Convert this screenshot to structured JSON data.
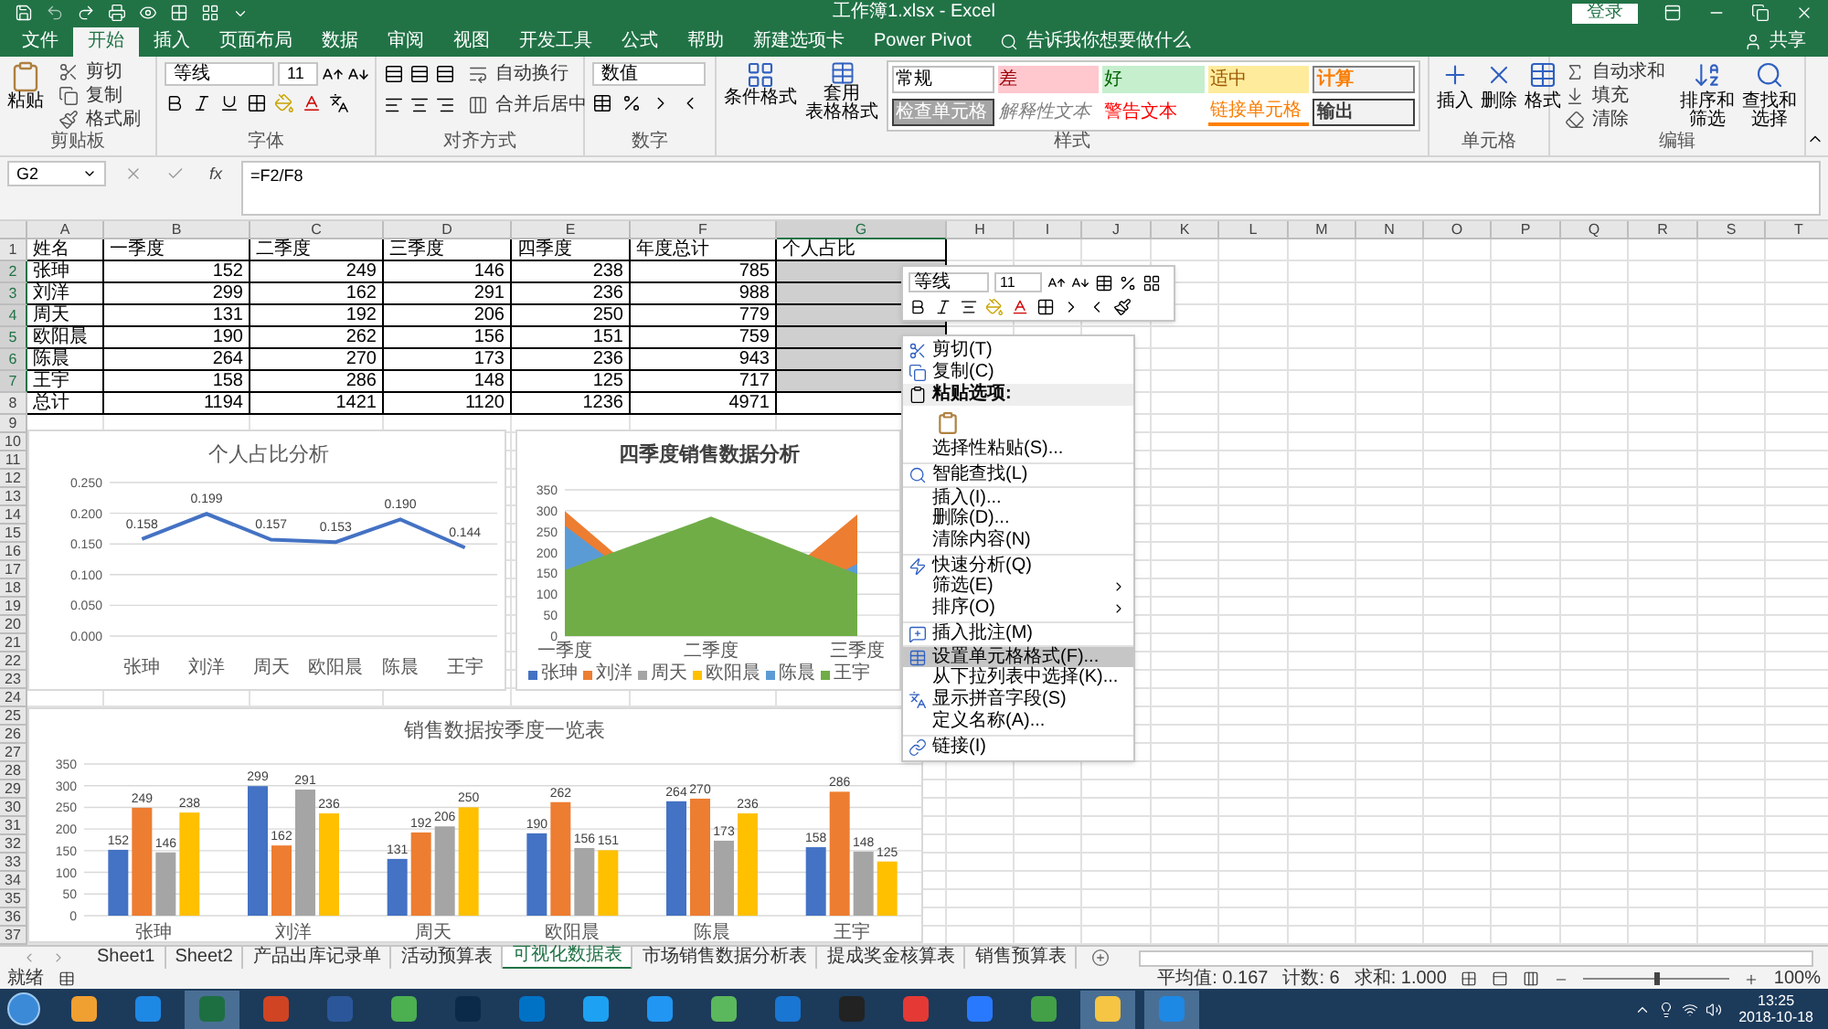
{
  "title_bar": {
    "title": "工作簿1.xlsx  -  Excel",
    "login": "登录",
    "share": "共享"
  },
  "ribbon_tabs": [
    {
      "label": "文件",
      "selected": false
    },
    {
      "label": "开始",
      "selected": true
    },
    {
      "label": "插入",
      "selected": false
    },
    {
      "label": "页面布局",
      "selected": false
    },
    {
      "label": "数据",
      "selected": false
    },
    {
      "label": "审阅",
      "selected": false
    },
    {
      "label": "视图",
      "selected": false
    },
    {
      "label": "开发工具",
      "selected": false
    },
    {
      "label": "公式",
      "selected": false
    },
    {
      "label": "帮助",
      "selected": false
    },
    {
      "label": "新建选项卡",
      "selected": false
    },
    {
      "label": "Power Pivot",
      "selected": false
    }
  ],
  "tell_me": "告诉我你想要做什么",
  "ribbon": {
    "clipboard": {
      "label": "剪贴板",
      "paste": "粘贴",
      "cut": "剪切",
      "copy": "复制",
      "format_painter": "格式刷"
    },
    "font": {
      "label": "字体",
      "font_name": "等线",
      "font_size": "11"
    },
    "alignment": {
      "label": "对齐方式",
      "wrap": "自动换行",
      "merge": "合并后居中"
    },
    "number": {
      "label": "数字",
      "format": "数值"
    },
    "styles": {
      "label": "样式",
      "conditional": "条件格式",
      "table_format": [
        "套用",
        "表格格式"
      ],
      "gallery": [
        {
          "text": "常规",
          "kind": "normal"
        },
        {
          "text": "差",
          "kind": "bad"
        },
        {
          "text": "好",
          "kind": "good"
        },
        {
          "text": "适中",
          "kind": "neutral"
        },
        {
          "text": "计算",
          "kind": "calculation"
        },
        {
          "text": "检查单元格",
          "kind": "check"
        },
        {
          "text": "解释性文本",
          "kind": "explanatory"
        },
        {
          "text": "警告文本",
          "kind": "warning"
        },
        {
          "text": "链接单元格",
          "kind": "linked"
        },
        {
          "text": "输出",
          "kind": "output"
        }
      ]
    },
    "cells": {
      "label": "单元格",
      "buttons": [
        "插入",
        "删除",
        "格式"
      ]
    },
    "editing": {
      "label": "编辑",
      "autosum": "自动求和",
      "fill": "填充",
      "clear": "清除",
      "sort": "排序和筛选",
      "find": "查找和选择"
    }
  },
  "formula_bar": {
    "name_box": "G2",
    "fx": "fx",
    "formula": "=F2/F8"
  },
  "sheet": {
    "columns": [
      {
        "label": "A",
        "selected": false
      },
      {
        "label": "B",
        "selected": false
      },
      {
        "label": "C",
        "selected": false
      },
      {
        "label": "D",
        "selected": false
      },
      {
        "label": "E",
        "selected": false
      },
      {
        "label": "F",
        "selected": false
      },
      {
        "label": "G",
        "selected": true
      },
      {
        "label": "H",
        "selected": false
      },
      {
        "label": "I",
        "selected": false
      },
      {
        "label": "J",
        "selected": false
      },
      {
        "label": "K",
        "selected": false
      },
      {
        "label": "L",
        "selected": false
      },
      {
        "label": "M",
        "selected": false
      },
      {
        "label": "N",
        "selected": false
      },
      {
        "label": "O",
        "selected": false
      },
      {
        "label": "P",
        "selected": false
      },
      {
        "label": "Q",
        "selected": false
      },
      {
        "label": "R",
        "selected": false
      },
      {
        "label": "S",
        "selected": false
      },
      {
        "label": "T",
        "selected": false
      }
    ],
    "rows": [
      {
        "number": "1",
        "selected": false,
        "cells": [
          {
            "text": "姓名",
            "selected": false
          },
          {
            "text": "一季度",
            "selected": false
          },
          {
            "text": "二季度",
            "selected": false
          },
          {
            "text": "三季度",
            "selected": false
          },
          {
            "text": "四季度",
            "selected": false
          },
          {
            "text": "年度总计",
            "selected": false
          },
          {
            "text": "个人占比",
            "selected": false
          }
        ]
      },
      {
        "number": "2",
        "selected": true,
        "cells": [
          {
            "text": "张珅",
            "selected": false
          },
          {
            "text": "152",
            "selected": false
          },
          {
            "text": "249",
            "selected": false
          },
          {
            "text": "146",
            "selected": false
          },
          {
            "text": "238",
            "selected": false
          },
          {
            "text": "785",
            "selected": false
          },
          {
            "selected": true
          }
        ]
      },
      {
        "number": "3",
        "selected": true,
        "cells": [
          {
            "text": "刘洋",
            "selected": false
          },
          {
            "text": "299",
            "selected": false
          },
          {
            "text": "162",
            "selected": false
          },
          {
            "text": "291",
            "selected": false
          },
          {
            "text": "236",
            "selected": false
          },
          {
            "text": "988",
            "selected": false
          },
          {
            "selected": true
          }
        ]
      },
      {
        "number": "4",
        "selected": true,
        "cells": [
          {
            "text": "周天",
            "selected": false
          },
          {
            "text": "131",
            "selected": false
          },
          {
            "text": "192",
            "selected": false
          },
          {
            "text": "206",
            "selected": false
          },
          {
            "text": "250",
            "selected": false
          },
          {
            "text": "779",
            "selected": false
          },
          {
            "selected": true
          }
        ]
      },
      {
        "number": "5",
        "selected": true,
        "cells": [
          {
            "text": "欧阳晨",
            "selected": false
          },
          {
            "text": "190",
            "selected": false
          },
          {
            "text": "262",
            "selected": false
          },
          {
            "text": "156",
            "selected": false
          },
          {
            "text": "151",
            "selected": false
          },
          {
            "text": "759",
            "selected": false
          },
          {
            "selected": true
          }
        ]
      },
      {
        "number": "6",
        "selected": true,
        "cells": [
          {
            "text": "陈晨",
            "selected": false
          },
          {
            "text": "264",
            "selected": false
          },
          {
            "text": "270",
            "selected": false
          },
          {
            "text": "173",
            "selected": false
          },
          {
            "text": "236",
            "selected": false
          },
          {
            "text": "943",
            "selected": false
          },
          {
            "selected": true
          }
        ]
      },
      {
        "number": "7",
        "selected": true,
        "cells": [
          {
            "text": "王宇",
            "selected": false
          },
          {
            "text": "158",
            "selected": false
          },
          {
            "text": "286",
            "selected": false
          },
          {
            "text": "148",
            "selected": false
          },
          {
            "text": "125",
            "selected": false
          },
          {
            "text": "717",
            "selected": false
          },
          {
            "selected": true
          }
        ]
      },
      {
        "number": "8",
        "selected": false,
        "cells": [
          {
            "text": "总计",
            "selected": false
          },
          {
            "text": "1194",
            "selected": false
          },
          {
            "text": "1421",
            "selected": false
          },
          {
            "text": "1120",
            "selected": false
          },
          {
            "text": "1236",
            "selected": false
          },
          {
            "text": "4971",
            "selected": false
          },
          {
            "selected": false
          }
        ]
      },
      {
        "number": "9",
        "selected": false
      },
      {
        "number": "10",
        "selected": false
      },
      {
        "number": "11",
        "selected": false
      },
      {
        "number": "12",
        "selected": false
      },
      {
        "number": "13",
        "selected": false
      },
      {
        "number": "14",
        "selected": false
      },
      {
        "number": "15",
        "selected": false
      },
      {
        "number": "16",
        "selected": false
      },
      {
        "number": "17",
        "selected": false
      },
      {
        "number": "18",
        "selected": false
      },
      {
        "number": "19",
        "selected": false
      },
      {
        "number": "20",
        "selected": false
      },
      {
        "number": "21",
        "selected": false
      },
      {
        "number": "22",
        "selected": false
      },
      {
        "number": "23",
        "selected": false
      },
      {
        "number": "24",
        "selected": false
      },
      {
        "number": "25",
        "selected": false
      },
      {
        "number": "26",
        "selected": false
      },
      {
        "number": "27",
        "selected": false
      },
      {
        "number": "28",
        "selected": false
      },
      {
        "number": "29",
        "selected": false
      },
      {
        "number": "30",
        "selected": false
      },
      {
        "number": "31",
        "selected": false
      },
      {
        "number": "32",
        "selected": false
      },
      {
        "number": "33",
        "selected": false
      },
      {
        "number": "34",
        "selected": false
      },
      {
        "number": "35",
        "selected": false
      },
      {
        "number": "36",
        "selected": false
      },
      {
        "number": "37",
        "selected": false
      }
    ]
  },
  "charts": [
    {
      "chart_data": {
        "type": "line",
        "title": "个人占比分析",
        "categories": [
          "张珅",
          "刘洋",
          "周天",
          "欧阳晨",
          "陈晨",
          "王宇"
        ],
        "ylim": [
          0,
          0.25
        ],
        "yticks": [
          {
            "value": 0,
            "label": "0.000"
          },
          {
            "value": 0.05,
            "label": "0.050"
          },
          {
            "value": 0.1,
            "label": "0.100"
          },
          {
            "value": 0.15,
            "label": "0.150"
          },
          {
            "value": 0.2,
            "label": "0.200"
          },
          {
            "value": 0.25,
            "label": "0.250"
          }
        ],
        "grid": true,
        "value_labels": [
          "0.158",
          "0.199",
          "0.157",
          "0.153",
          "0.190",
          "0.144"
        ],
        "series": [
          {
            "color": "#4472c4",
            "values": [
              0.158,
              0.199,
              0.157,
              0.153,
              0.19,
              0.144
            ]
          }
        ]
      }
    },
    {
      "chart_data": {
        "type": "area",
        "title": "四季度销售数据分析",
        "categories": [
          "一季度",
          "二季度",
          "三季度"
        ],
        "ylim": [
          0,
          350
        ],
        "yticks": [
          0,
          50,
          100,
          150,
          200,
          250,
          300,
          350
        ],
        "stacked": false,
        "grid": true,
        "legend": "bottom",
        "series": [
          {
            "name": "张珅",
            "color": "#4472c4",
            "values": [
              null,
              null,
              null
            ]
          },
          {
            "name": "刘洋",
            "color": "#ed7d31",
            "values": [
              299,
              null,
              291
            ]
          },
          {
            "name": "周天",
            "color": "#a5a5a5",
            "values": [
              null,
              null,
              null
            ]
          },
          {
            "name": "欧阳晨",
            "color": "#ffc000",
            "values": [
              null,
              null,
              null
            ]
          },
          {
            "name": "陈晨",
            "color": "#5b9bd5",
            "values": [
              264,
              null,
              173
            ]
          },
          {
            "name": "王宇",
            "color": "#70ad47",
            "values": [
              158,
              286,
              148
            ]
          }
        ]
      }
    },
    {
      "chart_data": {
        "type": "bar",
        "title": "销售数据按季度一览表",
        "categories": [
          "张珅",
          "刘洋",
          "周天",
          "欧阳晨",
          "陈晨",
          "王宇"
        ],
        "ylim": [
          0,
          350
        ],
        "yticks": [
          0,
          50,
          100,
          150,
          200,
          250,
          300,
          350
        ],
        "grid": true,
        "data_labels": true,
        "series": [
          {
            "color": "#4472c4",
            "values": [
              152,
              299,
              131,
              190,
              264,
              158
            ]
          },
          {
            "color": "#ed7d31",
            "values": [
              249,
              162,
              192,
              262,
              270,
              286
            ]
          },
          {
            "color": "#a5a5a5",
            "values": [
              146,
              291,
              206,
              156,
              173,
              148
            ]
          },
          {
            "color": "#ffc000",
            "values": [
              238,
              236,
              250,
              151,
              236,
              125
            ]
          }
        ]
      }
    }
  ],
  "mini_toolbar": {
    "font_name": "等线",
    "font_size": "11"
  },
  "context_menu": [
    {
      "kind": "item",
      "label": "剪切(T)",
      "selected": false,
      "separator_before": false
    },
    {
      "kind": "item",
      "label": "复制(C)",
      "selected": false,
      "separator_before": false
    },
    {
      "kind": "header",
      "label": "粘贴选项:",
      "selected": false,
      "separator_before": false
    },
    {
      "kind": "paste",
      "selected": false,
      "separator_before": false
    },
    {
      "kind": "item",
      "label": "选择性粘贴(S)...",
      "selected": false,
      "separator_before": false
    },
    {
      "kind": "item",
      "label": "智能查找(L)",
      "selected": false,
      "separator_before": true
    },
    {
      "kind": "item",
      "label": "插入(I)...",
      "selected": false,
      "separator_before": true
    },
    {
      "kind": "item",
      "label": "删除(D)...",
      "selected": false,
      "separator_before": false
    },
    {
      "kind": "item",
      "label": "清除内容(N)",
      "selected": false,
      "separator_before": false
    },
    {
      "kind": "item",
      "label": "快速分析(Q)",
      "selected": false,
      "separator_before": true
    },
    {
      "kind": "submenu",
      "label": "筛选(E)",
      "selected": false,
      "separator_before": false
    },
    {
      "kind": "submenu",
      "label": "排序(O)",
      "selected": false,
      "separator_before": false
    },
    {
      "kind": "item",
      "label": "插入批注(M)",
      "selected": false,
      "separator_before": true
    },
    {
      "kind": "item",
      "label": "设置单元格格式(F)...",
      "selected": true,
      "separator_before": true
    },
    {
      "kind": "item",
      "label": "从下拉列表中选择(K)...",
      "selected": false,
      "separator_before": false
    },
    {
      "kind": "item",
      "label": "显示拼音字段(S)",
      "selected": false,
      "separator_before": false
    },
    {
      "kind": "item",
      "label": "定义名称(A)...",
      "selected": false,
      "separator_before": false
    },
    {
      "kind": "item",
      "label": "链接(I)",
      "selected": false,
      "separator_before": true
    }
  ],
  "sheet_tabs": [
    {
      "label": "Sheet1",
      "selected": false
    },
    {
      "label": "Sheet2",
      "selected": false
    },
    {
      "label": "产品出库记录单",
      "selected": false
    },
    {
      "label": "活动预算表",
      "selected": false
    },
    {
      "label": "可视化数据表",
      "selected": true
    },
    {
      "label": "市场销售数据分析表",
      "selected": false
    },
    {
      "label": "提成奖金核算表",
      "selected": false
    },
    {
      "label": "销售预算表",
      "selected": false
    }
  ],
  "status_bar": {
    "ready": "就绪",
    "average": "平均值: 0.167",
    "count": "计数: 6",
    "sum": "求和: 1.000",
    "zoom": "100%",
    "zoom_slider": {
      "level": 0.5
    }
  },
  "taskbar": {
    "apps": [
      {
        "color": "#f0a030",
        "selected": false
      },
      {
        "color": "#1e88e5",
        "selected": false
      },
      {
        "color": "#1d6f42",
        "selected": true
      },
      {
        "color": "#d04423",
        "selected": false
      },
      {
        "color": "#2b579a",
        "selected": false
      },
      {
        "color": "#4caf50",
        "selected": false
      },
      {
        "color": "#0b2a4a",
        "selected": false
      },
      {
        "color": "#0072c6",
        "selected": false
      },
      {
        "color": "#1da1f2",
        "selected": false
      },
      {
        "color": "#2196f3",
        "selected": false
      },
      {
        "color": "#5cb85c",
        "selected": false
      },
      {
        "color": "#1976d2",
        "selected": false
      },
      {
        "color": "#222222",
        "selected": false
      },
      {
        "color": "#e53935",
        "selected": false
      },
      {
        "color": "#2979ff",
        "selected": false
      },
      {
        "color": "#43a047",
        "selected": false
      },
      {
        "color": "#f6c544",
        "selected": true
      },
      {
        "color": "#1e88e5",
        "selected": true
      }
    ],
    "time": "13:25",
    "date": "2018-10-18"
  }
}
